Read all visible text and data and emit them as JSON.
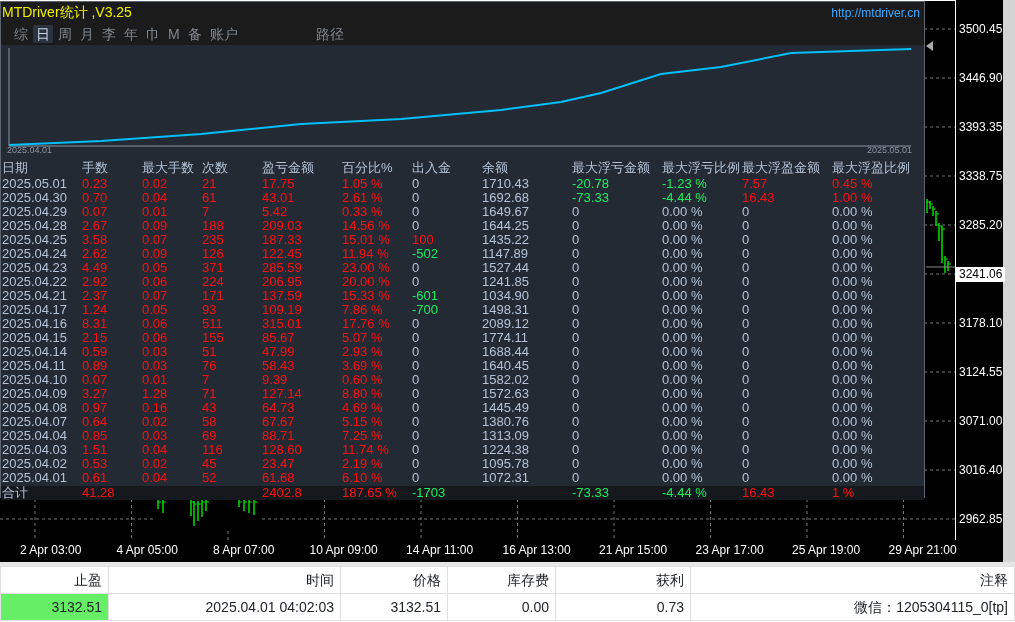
{
  "stats_panel": {
    "title": "MTDriver统计 ,V3.25",
    "url": "http://mtdriver.cn",
    "tabs": [
      {
        "label": "综",
        "selected": false
      },
      {
        "label": "日",
        "selected": true
      },
      {
        "label": "周",
        "selected": false
      },
      {
        "label": "月",
        "selected": false
      },
      {
        "label": "李",
        "selected": false
      },
      {
        "label": "年",
        "selected": false
      },
      {
        "label": "巾",
        "selected": false
      },
      {
        "label": "M",
        "selected": false
      },
      {
        "label": "备",
        "selected": false
      },
      {
        "label": "账户",
        "selected": false
      }
    ],
    "path_button": "路径",
    "equity_chart": {
      "start_label": "2025.04.01",
      "end_label": "2025.05.01"
    },
    "table": {
      "columns": [
        "日期",
        "手数",
        "最大手数",
        "次数",
        "盈亏金额",
        "百分比%",
        "出入金",
        "余额",
        "最大浮亏金额",
        "最大浮亏比例",
        "最大浮盈金额",
        "最大浮盈比例"
      ],
      "rows": [
        {
          "cells": [
            {
              "text": "2025.05.01",
              "color": "#b4c3d8"
            },
            {
              "text": "0.23",
              "color": "#ff1010"
            },
            {
              "text": "0.02",
              "color": "#ff1010"
            },
            {
              "text": "21",
              "color": "#ff1010"
            },
            {
              "text": "17.75",
              "color": "#ff1010"
            },
            {
              "text": "1.05 %",
              "color": "#ff1010"
            },
            {
              "text": "0",
              "color": "#b4c3d8"
            },
            {
              "text": "1710.43",
              "color": "#b4c3d8"
            },
            {
              "text": "-20.78",
              "color": "#19f060"
            },
            {
              "text": "-1.23 %",
              "color": "#19f060"
            },
            {
              "text": "7.57",
              "color": "#ff1010"
            },
            {
              "text": "0.45 %",
              "color": "#ff1010"
            }
          ]
        },
        {
          "cells": [
            {
              "text": "2025.04.30",
              "color": "#b4c3d8"
            },
            {
              "text": "0.70",
              "color": "#ff1010"
            },
            {
              "text": "0.04",
              "color": "#ff1010"
            },
            {
              "text": "61",
              "color": "#ff1010"
            },
            {
              "text": "43.01",
              "color": "#ff1010"
            },
            {
              "text": "2.61 %",
              "color": "#ff1010"
            },
            {
              "text": "0",
              "color": "#b4c3d8"
            },
            {
              "text": "1692.68",
              "color": "#b4c3d8"
            },
            {
              "text": "-73.33",
              "color": "#19f060"
            },
            {
              "text": "-4.44 %",
              "color": "#19f060"
            },
            {
              "text": "16.43",
              "color": "#ff1010"
            },
            {
              "text": "1.00 %",
              "color": "#ff1010"
            }
          ]
        },
        {
          "cells": [
            {
              "text": "2025.04.29",
              "color": "#b4c3d8"
            },
            {
              "text": "0.07",
              "color": "#ff1010"
            },
            {
              "text": "0.01",
              "color": "#ff1010"
            },
            {
              "text": "7",
              "color": "#ff1010"
            },
            {
              "text": "5.42",
              "color": "#ff1010"
            },
            {
              "text": "0.33 %",
              "color": "#ff1010"
            },
            {
              "text": "0",
              "color": "#b4c3d8"
            },
            {
              "text": "1649.67",
              "color": "#b4c3d8"
            },
            {
              "text": "0",
              "color": "#b4c3d8"
            },
            {
              "text": "0.00 %",
              "color": "#b4c3d8"
            },
            {
              "text": "0",
              "color": "#b4c3d8"
            },
            {
              "text": "0.00 %",
              "color": "#b4c3d8"
            }
          ]
        },
        {
          "cells": [
            {
              "text": "2025.04.28",
              "color": "#b4c3d8"
            },
            {
              "text": "2.67",
              "color": "#ff1010"
            },
            {
              "text": "0.09",
              "color": "#ff1010"
            },
            {
              "text": "188",
              "color": "#ff1010"
            },
            {
              "text": "209.03",
              "color": "#ff1010"
            },
            {
              "text": "14.56 %",
              "color": "#ff1010"
            },
            {
              "text": "0",
              "color": "#b4c3d8"
            },
            {
              "text": "1644.25",
              "color": "#b4c3d8"
            },
            {
              "text": "0",
              "color": "#b4c3d8"
            },
            {
              "text": "0.00 %",
              "color": "#b4c3d8"
            },
            {
              "text": "0",
              "color": "#b4c3d8"
            },
            {
              "text": "0.00 %",
              "color": "#b4c3d8"
            }
          ]
        },
        {
          "cells": [
            {
              "text": "2025.04.25",
              "color": "#b4c3d8"
            },
            {
              "text": "3.58",
              "color": "#ff1010"
            },
            {
              "text": "0.07",
              "color": "#ff1010"
            },
            {
              "text": "235",
              "color": "#ff1010"
            },
            {
              "text": "187.33",
              "color": "#ff1010"
            },
            {
              "text": "15.01 %",
              "color": "#ff1010"
            },
            {
              "text": "100",
              "color": "#ff1010"
            },
            {
              "text": "1435.22",
              "color": "#b4c3d8"
            },
            {
              "text": "0",
              "color": "#b4c3d8"
            },
            {
              "text": "0.00 %",
              "color": "#b4c3d8"
            },
            {
              "text": "0",
              "color": "#b4c3d8"
            },
            {
              "text": "0.00 %",
              "color": "#b4c3d8"
            }
          ]
        },
        {
          "cells": [
            {
              "text": "2025.04.24",
              "color": "#b4c3d8"
            },
            {
              "text": "2.62",
              "color": "#ff1010"
            },
            {
              "text": "0.09",
              "color": "#ff1010"
            },
            {
              "text": "126",
              "color": "#ff1010"
            },
            {
              "text": "122.45",
              "color": "#ff1010"
            },
            {
              "text": "11.94 %",
              "color": "#ff1010"
            },
            {
              "text": "-502",
              "color": "#19f060"
            },
            {
              "text": "1147.89",
              "color": "#b4c3d8"
            },
            {
              "text": "0",
              "color": "#b4c3d8"
            },
            {
              "text": "0.00 %",
              "color": "#b4c3d8"
            },
            {
              "text": "0",
              "color": "#b4c3d8"
            },
            {
              "text": "0.00 %",
              "color": "#b4c3d8"
            }
          ]
        },
        {
          "cells": [
            {
              "text": "2025.04.23",
              "color": "#b4c3d8"
            },
            {
              "text": "4.49",
              "color": "#ff1010"
            },
            {
              "text": "0.05",
              "color": "#ff1010"
            },
            {
              "text": "371",
              "color": "#ff1010"
            },
            {
              "text": "285.59",
              "color": "#ff1010"
            },
            {
              "text": "23.00 %",
              "color": "#ff1010"
            },
            {
              "text": "0",
              "color": "#b4c3d8"
            },
            {
              "text": "1527.44",
              "color": "#b4c3d8"
            },
            {
              "text": "0",
              "color": "#b4c3d8"
            },
            {
              "text": "0.00 %",
              "color": "#b4c3d8"
            },
            {
              "text": "0",
              "color": "#b4c3d8"
            },
            {
              "text": "0.00 %",
              "color": "#b4c3d8"
            }
          ]
        },
        {
          "cells": [
            {
              "text": "2025.04.22",
              "color": "#b4c3d8"
            },
            {
              "text": "2.92",
              "color": "#ff1010"
            },
            {
              "text": "0.06",
              "color": "#ff1010"
            },
            {
              "text": "224",
              "color": "#ff1010"
            },
            {
              "text": "206.95",
              "color": "#ff1010"
            },
            {
              "text": "20.00 %",
              "color": "#ff1010"
            },
            {
              "text": "0",
              "color": "#b4c3d8"
            },
            {
              "text": "1241.85",
              "color": "#b4c3d8"
            },
            {
              "text": "0",
              "color": "#b4c3d8"
            },
            {
              "text": "0.00 %",
              "color": "#b4c3d8"
            },
            {
              "text": "0",
              "color": "#b4c3d8"
            },
            {
              "text": "0.00 %",
              "color": "#b4c3d8"
            }
          ]
        },
        {
          "cells": [
            {
              "text": "2025.04.21",
              "color": "#b4c3d8"
            },
            {
              "text": "2.37",
              "color": "#ff1010"
            },
            {
              "text": "0.07",
              "color": "#ff1010"
            },
            {
              "text": "171",
              "color": "#ff1010"
            },
            {
              "text": "137.59",
              "color": "#ff1010"
            },
            {
              "text": "15.33 %",
              "color": "#ff1010"
            },
            {
              "text": "-601",
              "color": "#19f060"
            },
            {
              "text": "1034.90",
              "color": "#b4c3d8"
            },
            {
              "text": "0",
              "color": "#b4c3d8"
            },
            {
              "text": "0.00 %",
              "color": "#b4c3d8"
            },
            {
              "text": "0",
              "color": "#b4c3d8"
            },
            {
              "text": "0.00 %",
              "color": "#b4c3d8"
            }
          ]
        },
        {
          "cells": [
            {
              "text": "2025.04.17",
              "color": "#b4c3d8"
            },
            {
              "text": "1.24",
              "color": "#ff1010"
            },
            {
              "text": "0.05",
              "color": "#ff1010"
            },
            {
              "text": "93",
              "color": "#ff1010"
            },
            {
              "text": "109.19",
              "color": "#ff1010"
            },
            {
              "text": "7.86 %",
              "color": "#ff1010"
            },
            {
              "text": "-700",
              "color": "#19f060"
            },
            {
              "text": "1498.31",
              "color": "#b4c3d8"
            },
            {
              "text": "0",
              "color": "#b4c3d8"
            },
            {
              "text": "0.00 %",
              "color": "#b4c3d8"
            },
            {
              "text": "0",
              "color": "#b4c3d8"
            },
            {
              "text": "0.00 %",
              "color": "#b4c3d8"
            }
          ]
        },
        {
          "cells": [
            {
              "text": "2025.04.16",
              "color": "#b4c3d8"
            },
            {
              "text": "8.31",
              "color": "#ff1010"
            },
            {
              "text": "0.06",
              "color": "#ff1010"
            },
            {
              "text": "511",
              "color": "#ff1010"
            },
            {
              "text": "315.01",
              "color": "#ff1010"
            },
            {
              "text": "17.76 %",
              "color": "#ff1010"
            },
            {
              "text": "0",
              "color": "#b4c3d8"
            },
            {
              "text": "2089.12",
              "color": "#b4c3d8"
            },
            {
              "text": "0",
              "color": "#b4c3d8"
            },
            {
              "text": "0.00 %",
              "color": "#b4c3d8"
            },
            {
              "text": "0",
              "color": "#b4c3d8"
            },
            {
              "text": "0.00 %",
              "color": "#b4c3d8"
            }
          ]
        },
        {
          "cells": [
            {
              "text": "2025.04.15",
              "color": "#b4c3d8"
            },
            {
              "text": "2.15",
              "color": "#ff1010"
            },
            {
              "text": "0.06",
              "color": "#ff1010"
            },
            {
              "text": "155",
              "color": "#ff1010"
            },
            {
              "text": "85.67",
              "color": "#ff1010"
            },
            {
              "text": "5.07 %",
              "color": "#ff1010"
            },
            {
              "text": "0",
              "color": "#b4c3d8"
            },
            {
              "text": "1774.11",
              "color": "#b4c3d8"
            },
            {
              "text": "0",
              "color": "#b4c3d8"
            },
            {
              "text": "0.00 %",
              "color": "#b4c3d8"
            },
            {
              "text": "0",
              "color": "#b4c3d8"
            },
            {
              "text": "0.00 %",
              "color": "#b4c3d8"
            }
          ]
        },
        {
          "cells": [
            {
              "text": "2025.04.14",
              "color": "#b4c3d8"
            },
            {
              "text": "0.59",
              "color": "#ff1010"
            },
            {
              "text": "0.03",
              "color": "#ff1010"
            },
            {
              "text": "51",
              "color": "#ff1010"
            },
            {
              "text": "47.99",
              "color": "#ff1010"
            },
            {
              "text": "2.93 %",
              "color": "#ff1010"
            },
            {
              "text": "0",
              "color": "#b4c3d8"
            },
            {
              "text": "1688.44",
              "color": "#b4c3d8"
            },
            {
              "text": "0",
              "color": "#b4c3d8"
            },
            {
              "text": "0.00 %",
              "color": "#b4c3d8"
            },
            {
              "text": "0",
              "color": "#b4c3d8"
            },
            {
              "text": "0.00 %",
              "color": "#b4c3d8"
            }
          ]
        },
        {
          "cells": [
            {
              "text": "2025.04.11",
              "color": "#b4c3d8"
            },
            {
              "text": "0.89",
              "color": "#ff1010"
            },
            {
              "text": "0.03",
              "color": "#ff1010"
            },
            {
              "text": "76",
              "color": "#ff1010"
            },
            {
              "text": "58.43",
              "color": "#ff1010"
            },
            {
              "text": "3.69 %",
              "color": "#ff1010"
            },
            {
              "text": "0",
              "color": "#b4c3d8"
            },
            {
              "text": "1640.45",
              "color": "#b4c3d8"
            },
            {
              "text": "0",
              "color": "#b4c3d8"
            },
            {
              "text": "0.00 %",
              "color": "#b4c3d8"
            },
            {
              "text": "0",
              "color": "#b4c3d8"
            },
            {
              "text": "0.00 %",
              "color": "#b4c3d8"
            }
          ]
        },
        {
          "cells": [
            {
              "text": "2025.04.10",
              "color": "#b4c3d8"
            },
            {
              "text": "0.07",
              "color": "#ff1010"
            },
            {
              "text": "0.01",
              "color": "#ff1010"
            },
            {
              "text": "7",
              "color": "#ff1010"
            },
            {
              "text": "9.39",
              "color": "#ff1010"
            },
            {
              "text": "0.60 %",
              "color": "#ff1010"
            },
            {
              "text": "0",
              "color": "#b4c3d8"
            },
            {
              "text": "1582.02",
              "color": "#b4c3d8"
            },
            {
              "text": "0",
              "color": "#b4c3d8"
            },
            {
              "text": "0.00 %",
              "color": "#b4c3d8"
            },
            {
              "text": "0",
              "color": "#b4c3d8"
            },
            {
              "text": "0.00 %",
              "color": "#b4c3d8"
            }
          ]
        },
        {
          "cells": [
            {
              "text": "2025.04.09",
              "color": "#b4c3d8"
            },
            {
              "text": "3.27",
              "color": "#ff1010"
            },
            {
              "text": "1.28",
              "color": "#ff1010"
            },
            {
              "text": "71",
              "color": "#ff1010"
            },
            {
              "text": "127.14",
              "color": "#ff1010"
            },
            {
              "text": "8.80 %",
              "color": "#ff1010"
            },
            {
              "text": "0",
              "color": "#b4c3d8"
            },
            {
              "text": "1572.63",
              "color": "#b4c3d8"
            },
            {
              "text": "0",
              "color": "#b4c3d8"
            },
            {
              "text": "0.00 %",
              "color": "#b4c3d8"
            },
            {
              "text": "0",
              "color": "#b4c3d8"
            },
            {
              "text": "0.00 %",
              "color": "#b4c3d8"
            }
          ]
        },
        {
          "cells": [
            {
              "text": "2025.04.08",
              "color": "#b4c3d8"
            },
            {
              "text": "0.97",
              "color": "#ff1010"
            },
            {
              "text": "0.16",
              "color": "#ff1010"
            },
            {
              "text": "43",
              "color": "#ff1010"
            },
            {
              "text": "64.73",
              "color": "#ff1010"
            },
            {
              "text": "4.69 %",
              "color": "#ff1010"
            },
            {
              "text": "0",
              "color": "#b4c3d8"
            },
            {
              "text": "1445.49",
              "color": "#b4c3d8"
            },
            {
              "text": "0",
              "color": "#b4c3d8"
            },
            {
              "text": "0.00 %",
              "color": "#b4c3d8"
            },
            {
              "text": "0",
              "color": "#b4c3d8"
            },
            {
              "text": "0.00 %",
              "color": "#b4c3d8"
            }
          ]
        },
        {
          "cells": [
            {
              "text": "2025.04.07",
              "color": "#b4c3d8"
            },
            {
              "text": "0.64",
              "color": "#ff1010"
            },
            {
              "text": "0.02",
              "color": "#ff1010"
            },
            {
              "text": "58",
              "color": "#ff1010"
            },
            {
              "text": "67.67",
              "color": "#ff1010"
            },
            {
              "text": "5.15 %",
              "color": "#ff1010"
            },
            {
              "text": "0",
              "color": "#b4c3d8"
            },
            {
              "text": "1380.76",
              "color": "#b4c3d8"
            },
            {
              "text": "0",
              "color": "#b4c3d8"
            },
            {
              "text": "0.00 %",
              "color": "#b4c3d8"
            },
            {
              "text": "0",
              "color": "#b4c3d8"
            },
            {
              "text": "0.00 %",
              "color": "#b4c3d8"
            }
          ]
        },
        {
          "cells": [
            {
              "text": "2025.04.04",
              "color": "#b4c3d8"
            },
            {
              "text": "0.85",
              "color": "#ff1010"
            },
            {
              "text": "0.03",
              "color": "#ff1010"
            },
            {
              "text": "69",
              "color": "#ff1010"
            },
            {
              "text": "88.71",
              "color": "#ff1010"
            },
            {
              "text": "7.25 %",
              "color": "#ff1010"
            },
            {
              "text": "0",
              "color": "#b4c3d8"
            },
            {
              "text": "1313.09",
              "color": "#b4c3d8"
            },
            {
              "text": "0",
              "color": "#b4c3d8"
            },
            {
              "text": "0.00 %",
              "color": "#b4c3d8"
            },
            {
              "text": "0",
              "color": "#b4c3d8"
            },
            {
              "text": "0.00 %",
              "color": "#b4c3d8"
            }
          ]
        },
        {
          "cells": [
            {
              "text": "2025.04.03",
              "color": "#b4c3d8"
            },
            {
              "text": "1.51",
              "color": "#ff1010"
            },
            {
              "text": "0.04",
              "color": "#ff1010"
            },
            {
              "text": "116",
              "color": "#ff1010"
            },
            {
              "text": "128.60",
              "color": "#ff1010"
            },
            {
              "text": "11.74 %",
              "color": "#ff1010"
            },
            {
              "text": "0",
              "color": "#b4c3d8"
            },
            {
              "text": "1224.38",
              "color": "#b4c3d8"
            },
            {
              "text": "0",
              "color": "#b4c3d8"
            },
            {
              "text": "0.00 %",
              "color": "#b4c3d8"
            },
            {
              "text": "0",
              "color": "#b4c3d8"
            },
            {
              "text": "0.00 %",
              "color": "#b4c3d8"
            }
          ]
        },
        {
          "cells": [
            {
              "text": "2025.04.02",
              "color": "#b4c3d8"
            },
            {
              "text": "0.53",
              "color": "#ff1010"
            },
            {
              "text": "0.02",
              "color": "#ff1010"
            },
            {
              "text": "45",
              "color": "#ff1010"
            },
            {
              "text": "23.47",
              "color": "#ff1010"
            },
            {
              "text": "2.19 %",
              "color": "#ff1010"
            },
            {
              "text": "0",
              "color": "#b4c3d8"
            },
            {
              "text": "1095.78",
              "color": "#b4c3d8"
            },
            {
              "text": "0",
              "color": "#b4c3d8"
            },
            {
              "text": "0.00 %",
              "color": "#b4c3d8"
            },
            {
              "text": "0",
              "color": "#b4c3d8"
            },
            {
              "text": "0.00 %",
              "color": "#b4c3d8"
            }
          ]
        },
        {
          "cells": [
            {
              "text": "2025.04.01",
              "color": "#b4c3d8"
            },
            {
              "text": "0.61",
              "color": "#ff1010"
            },
            {
              "text": "0.04",
              "color": "#ff1010"
            },
            {
              "text": "52",
              "color": "#ff1010"
            },
            {
              "text": "61.68",
              "color": "#ff1010"
            },
            {
              "text": "6.10 %",
              "color": "#ff1010"
            },
            {
              "text": "0",
              "color": "#b4c3d8"
            },
            {
              "text": "1072.31",
              "color": "#b4c3d8"
            },
            {
              "text": "0",
              "color": "#b4c3d8"
            },
            {
              "text": "0.00 %",
              "color": "#b4c3d8"
            },
            {
              "text": "0",
              "color": "#b4c3d8"
            },
            {
              "text": "0.00 %",
              "color": "#b4c3d8"
            }
          ]
        }
      ],
      "total": {
        "label": {
          "text": "合计",
          "color": "#b4c3d8"
        },
        "lots": {
          "text": "41.28",
          "color": "#ff1010"
        },
        "profit": {
          "text": "2402.8",
          "color": "#ff1010"
        },
        "percent": {
          "text": "187.65 %",
          "color": "#ff1010"
        },
        "deposit": {
          "text": "-1703",
          "color": "#19f060"
        },
        "max_float_loss": {
          "text": "-73.33",
          "color": "#19f060"
        },
        "max_float_loss_pct": {
          "text": "-4.44 %",
          "color": "#19f060"
        },
        "max_float_profit": {
          "text": "16.43",
          "color": "#ff1010"
        },
        "max_float_profit_pct": {
          "text": "1 %",
          "color": "#ff1010"
        }
      }
    }
  },
  "price_axis": {
    "upper": [
      "3500.45",
      "3446.90",
      "3393.35",
      "3338.75",
      "3285.20"
    ],
    "lower": [
      "3178.10",
      "3124.55",
      "3071.00",
      "3016.40",
      "2962.85"
    ]
  },
  "current_price": "3241.06",
  "time_axis": [
    "2 Apr 03:00",
    "4 Apr 05:00",
    "8 Apr 07:00",
    "10 Apr 09:00",
    "14 Apr 11:00",
    "16 Apr 13:00",
    "21 Apr 15:00",
    "23 Apr 17:00",
    "25 Apr 19:00",
    "29 Apr 21:00"
  ],
  "orders": {
    "columns": [
      "止盈",
      "时间",
      "价格",
      "库存费",
      "获利",
      "注释"
    ],
    "row": [
      {
        "text": "3132.51",
        "highlighted": true
      },
      {
        "text": "2025.04.01 04:02:03",
        "highlighted": false
      },
      {
        "text": "3132.51",
        "highlighted": false
      },
      {
        "text": "0.00",
        "highlighted": false
      },
      {
        "text": "0.73",
        "highlighted": false
      },
      {
        "text": "微信：1205304115_0[tp]",
        "highlighted": false
      }
    ]
  }
}
